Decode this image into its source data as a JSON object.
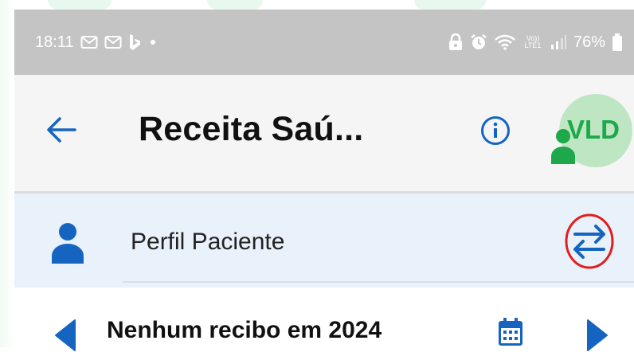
{
  "status_bar": {
    "time": "18:11",
    "notifications": [
      "mail-icon",
      "mail-icon",
      "bing-icon",
      "dot-icon"
    ],
    "right_icons": [
      "lock-icon",
      "alarm-icon",
      "wifi-icon",
      "volte-icon",
      "signal-icon"
    ],
    "network_label": "Vo)) LTE1",
    "battery": "76%"
  },
  "app_bar": {
    "title": "Receita Saú...",
    "avatar_initials": "VLD",
    "colors": {
      "avatar_bg": "#bfe6c3",
      "avatar_fg": "#1da84a",
      "accent": "#1565c0"
    }
  },
  "profile": {
    "label": "Perfil Paciente",
    "switch_highlight_color": "#e02020"
  },
  "navigator": {
    "text": "Nenhum recibo em 2024"
  }
}
